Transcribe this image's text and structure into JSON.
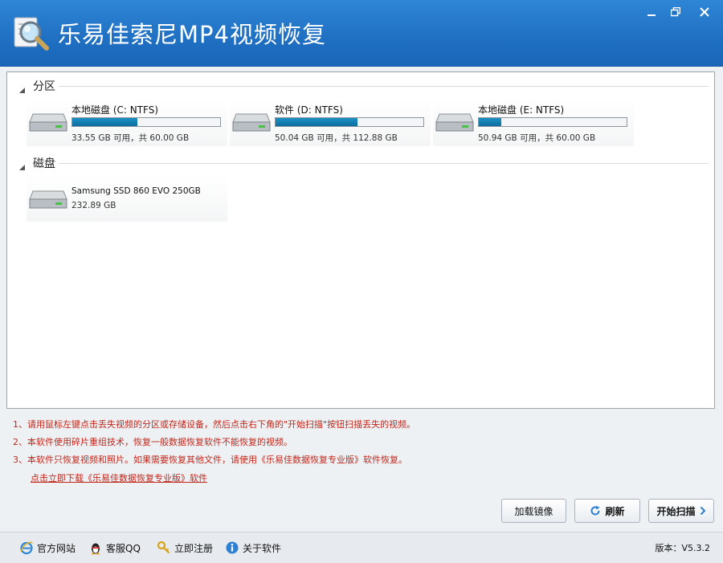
{
  "window": {
    "title": "乐易佳索尼MP4视频恢复",
    "controls": {
      "minimize": "minimize-icon",
      "restore": "restore-icon",
      "close": "close-icon"
    }
  },
  "colors": {
    "titlebar": "#1f6fc2",
    "usage_bar": "#1589be",
    "note_text": "#c3261a"
  },
  "sections": {
    "partitions": {
      "label": "分区"
    },
    "disks": {
      "label": "磁盘"
    }
  },
  "partitions": [
    {
      "name": "本地磁盘 (C: NTFS)",
      "space": "33.55 GB 可用，共 60.00 GB",
      "used_fraction": 0.44
    },
    {
      "name": "软件 (D: NTFS)",
      "space": "50.04 GB 可用，共 112.88 GB",
      "used_fraction": 0.557
    },
    {
      "name": "本地磁盘 (E: NTFS)",
      "space": "50.94 GB 可用，共 60.00 GB",
      "used_fraction": 0.151
    }
  ],
  "disks": [
    {
      "name": "Samsung SSD 860 EVO 250GB",
      "size": "232.89 GB"
    }
  ],
  "notes": [
    "1、请用鼠标左键点击丢失视频的分区或存储设备，然后点击右下角的\"开始扫描\"按钮扫描丢失的视频。",
    "2、本软件使用碎片重组技术，恢复一般数据恢复软件不能恢复的视频。",
    "3、本软件只恢复视频和照片。如果需要恢复其他文件，请使用《乐易佳数据恢复专业版》软件恢复。"
  ],
  "download_link": "点击立即下载《乐易佳数据恢复专业版》软件",
  "buttons": {
    "load_image": "加载镜像",
    "refresh": "刷新",
    "start_scan": "开始扫描"
  },
  "statusbar": {
    "official_site": "官方网站",
    "support_qq": "客服QQ",
    "register": "立即注册",
    "about": "关于软件",
    "version_label": "版本：",
    "version": "V5.3.2"
  }
}
